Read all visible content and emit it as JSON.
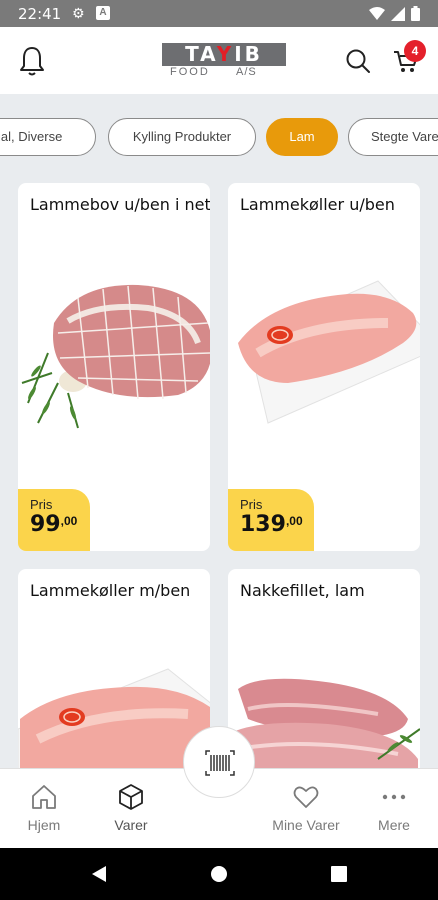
{
  "status_bar": {
    "time": "22:41",
    "icons": [
      "gear-icon",
      "a-icon",
      "wifi-icon",
      "signal-icon",
      "battery-icon"
    ]
  },
  "header": {
    "logo_word_1": "TA",
    "logo_word_y": "Y",
    "logo_word_2": "IB",
    "logo_sub_1": "FOOD",
    "logo_sub_2": "A/S",
    "cart_count": "4"
  },
  "categories": [
    "rial, Diverse",
    "Kylling Produkter",
    "Lam",
    "Stegte Varer"
  ],
  "selected_category": "Lam",
  "products": [
    {
      "name": "Lammebov u/ben i net",
      "price_label": "Pris",
      "price_int": "99",
      "price_dec": ",00"
    },
    {
      "name": "Lammekøller u/ben",
      "price_label": "Pris",
      "price_int": "139",
      "price_dec": ",00"
    },
    {
      "name": "Lammekøller m/ben"
    },
    {
      "name": "Nakkefillet, lam"
    }
  ],
  "bottom_nav": {
    "home": "Hjem",
    "products": "Varer",
    "my_products": "Mine Varer",
    "more": "Mere"
  },
  "colors": {
    "accent": "#e89a0b",
    "price_bg": "#fbd44b",
    "badge": "#e4202b",
    "background": "#e9ecef"
  }
}
